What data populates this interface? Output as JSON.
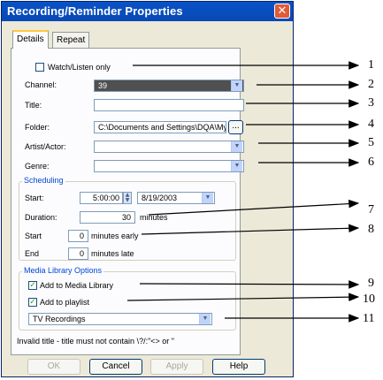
{
  "window": {
    "title": "Recording/Reminder Properties",
    "close_glyph": "✕"
  },
  "tabs": [
    {
      "label": "Details"
    },
    {
      "label": "Repeat"
    }
  ],
  "details": {
    "watch_only_label": "Watch/Listen only",
    "channel_label": "Channel:",
    "channel_value": "39",
    "title_label": "Title:",
    "title_value": "",
    "folder_label": "Folder:",
    "folder_value": "C:\\Documents and Settings\\DQA\\My",
    "browse_label": "...",
    "artist_label": "Artist/Actor:",
    "artist_value": "",
    "genre_label": "Genre:",
    "genre_value": ""
  },
  "scheduling": {
    "group_label": "Scheduling",
    "start_label": "Start:",
    "start_time": "5:00:00",
    "start_date": "8/19/2003",
    "duration_label": "Duration:",
    "duration_value": "30",
    "duration_unit": "minutes",
    "start_early_label": "Start",
    "start_early_value": "0",
    "start_early_unit": "minutes early",
    "end_late_label": "End",
    "end_late_value": "0",
    "end_late_unit": "minutes late"
  },
  "media_library": {
    "group_label": "Media Library Options",
    "add_media_label": "Add to Media Library",
    "add_media_checked": true,
    "add_playlist_label": "Add to playlist",
    "add_playlist_checked": true,
    "playlist_value": "TV Recordings"
  },
  "status_message": "Invalid title - title must not contain \\?/:\"<> or \"",
  "buttons": {
    "ok": "OK",
    "cancel": "Cancel",
    "apply": "Apply",
    "help": "Help"
  },
  "callouts": [
    "1",
    "2",
    "3",
    "4",
    "5",
    "6",
    "7",
    "8",
    "9",
    "10",
    "11"
  ],
  "colors": {
    "titlebar": "#0a52c8",
    "dialog_bg": "#ece9d8",
    "channel_bg": "#505050"
  }
}
